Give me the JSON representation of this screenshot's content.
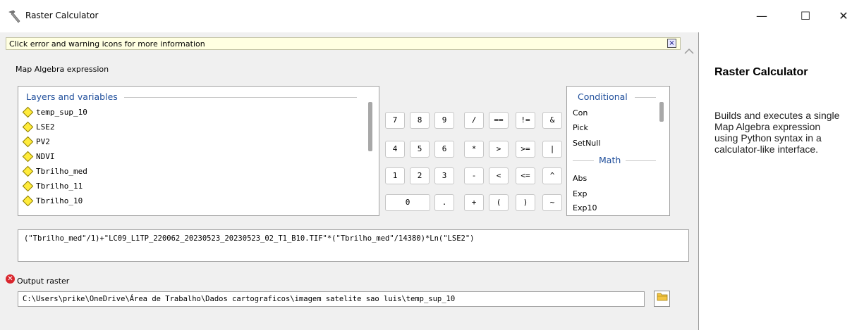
{
  "window": {
    "title": "Raster Calculator",
    "minimize_glyph": "—",
    "maximize_glyph": "☐",
    "close_glyph": "✕"
  },
  "info_bar": {
    "message": "Click error and warning icons for more information",
    "close_glyph": "×"
  },
  "expression_label": "Map Algebra expression",
  "layers_panel": {
    "header": "Layers and variables",
    "items": [
      "temp_sup_10",
      "LSE2",
      "PV2",
      "NDVI",
      "Tbrilho_med",
      "Tbrilho_11",
      "Tbrilho_10"
    ]
  },
  "calculator_buttons": {
    "row1": [
      "7",
      "8",
      "9",
      "/",
      "==",
      "!=",
      "&"
    ],
    "row2": [
      "4",
      "5",
      "6",
      "*",
      ">",
      ">=",
      "|"
    ],
    "row3": [
      "1",
      "2",
      "3",
      "-",
      "<",
      "<=",
      "^"
    ],
    "row4": [
      "0",
      ".",
      "+",
      "(",
      ")",
      "~"
    ]
  },
  "functions_panel": {
    "conditional_header": "Conditional",
    "conditional_items": [
      "Con",
      "Pick",
      "SetNull"
    ],
    "math_header": "Math",
    "math_items": [
      "Abs",
      "Exp",
      "Exp10"
    ]
  },
  "expression_text": "(\"Tbrilho_med\"/1)+\"LC09_L1TP_220062_20230523_20230523_02_T1_B10.TIF\"*(\"Tbrilho_med\"/14380)*Ln(\"LSE2\")",
  "output": {
    "label": "Output raster",
    "value": "C:\\Users\\prike\\OneDrive\\Área de Trabalho\\Dados cartograficos\\imagem satelite sao luis\\temp_sup_10",
    "error_glyph": "✕",
    "browse_glyph": "📂"
  },
  "help": {
    "title": "Raster Calculator",
    "description": "Builds and executes a single Map Algebra expression using Python syntax in a calculator-like interface."
  },
  "colors": {
    "info_bar_bg": "#ffffe1",
    "header_blue": "#1f4e9b",
    "layer_diamond": "#ffeb3b",
    "error_red": "#d9262d"
  }
}
